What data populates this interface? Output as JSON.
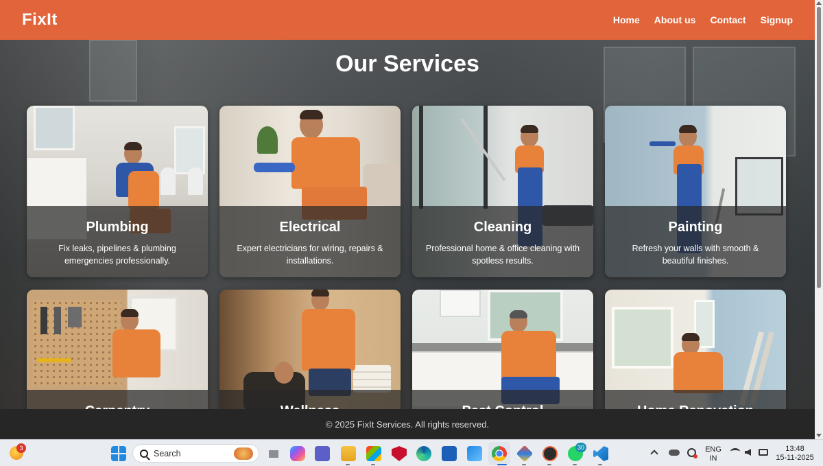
{
  "header": {
    "logo": "FixIt",
    "nav": [
      "Home",
      "About us",
      "Contact",
      "Signup"
    ]
  },
  "main": {
    "title": "Our Services",
    "services": [
      {
        "title": "Plumbing",
        "desc": "Fix leaks, pipelines & plumbing emergencies professionally."
      },
      {
        "title": "Electrical",
        "desc": "Expert electricians for wiring, repairs & installations."
      },
      {
        "title": "Cleaning",
        "desc": "Professional home & office cleaning with spotless results."
      },
      {
        "title": "Painting",
        "desc": "Refresh your walls with smooth & beautiful finishes."
      },
      {
        "title": "Carpentry",
        "desc": ""
      },
      {
        "title": "Wellness",
        "desc": ""
      },
      {
        "title": "Pest Control",
        "desc": ""
      },
      {
        "title": "Home Renovation",
        "desc": ""
      }
    ]
  },
  "footer": {
    "text": "© 2025 FixIt Services. All rights reserved."
  },
  "taskbar": {
    "search_placeholder": "Search",
    "notification_count": "3",
    "whatsapp_count": "30",
    "language_line1": "ENG",
    "language_line2": "IN",
    "time": "13:48",
    "date": "15-11-2025",
    "apps": [
      "widgets-icon",
      "start-icon",
      "task-view-icon",
      "copilot-icon",
      "teams-icon",
      "file-explorer-icon",
      "store-icon",
      "mcafee-icon",
      "edge-icon",
      "editor-icon",
      "photos-icon",
      "chrome-icon",
      "git-icon",
      "media-player-icon",
      "whatsapp-icon",
      "vscode-icon"
    ]
  },
  "colors": {
    "header_bg": "#e2643a",
    "footer_bg": "#262626",
    "card_overlay": "rgba(40,40,40,0.72)",
    "uniform_orange": "#e8823a"
  }
}
